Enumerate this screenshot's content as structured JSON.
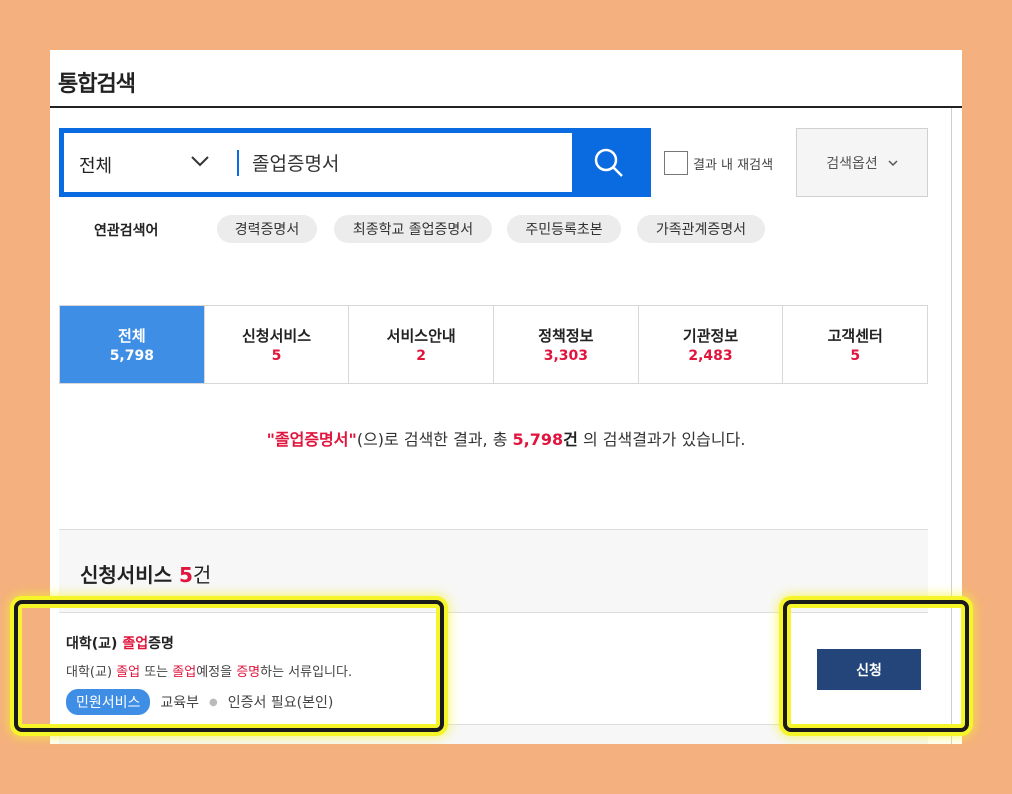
{
  "header": {
    "title": "통합검색"
  },
  "search": {
    "scope": "전체",
    "query": "졸업증명서",
    "recheck_label": "결과 내 재검색",
    "options_label": "검색옵션"
  },
  "related": {
    "label": "연관검색어",
    "chips": [
      "경력증명서",
      "최종학교 졸업증명서",
      "주민등록초본",
      "가족관계증명서"
    ]
  },
  "tabs": [
    {
      "name": "전체",
      "count": "5,798"
    },
    {
      "name": "신청서비스",
      "count": "5"
    },
    {
      "name": "서비스안내",
      "count": "2"
    },
    {
      "name": "정책정보",
      "count": "3,303"
    },
    {
      "name": "기관정보",
      "count": "2,483"
    },
    {
      "name": "고객센터",
      "count": "5"
    }
  ],
  "summary": {
    "keyword": "\"졸업증명서\"",
    "text1": "(으)로 검색한 결과, 총 ",
    "total": "5,798",
    "unit": "건",
    "text2": " 의 검색결과가 있습니다."
  },
  "section": {
    "title": "신청서비스",
    "count": "5",
    "unit": "건"
  },
  "item": {
    "title_a": "대학(교) ",
    "title_hl": "졸업",
    "title_b": "증명",
    "desc_1": "대학(교) ",
    "desc_hl1": "졸업",
    "desc_2": " 또는 ",
    "desc_hl2": "졸업",
    "desc_3": "예정을 ",
    "desc_hl3": "증명",
    "desc_4": "하는 서류입니다.",
    "badge": "민원서비스",
    "agency": "교육부",
    "requirement": "인증서 필요(본인)",
    "apply_label": "신청"
  },
  "colors": {
    "brand_blue": "#0a6be1",
    "active_tab": "#3f8ee6",
    "highlight_red": "#e0143c",
    "apply_button": "#23457a",
    "frame": "#f4b07e",
    "annotation": "#f6f52a"
  }
}
